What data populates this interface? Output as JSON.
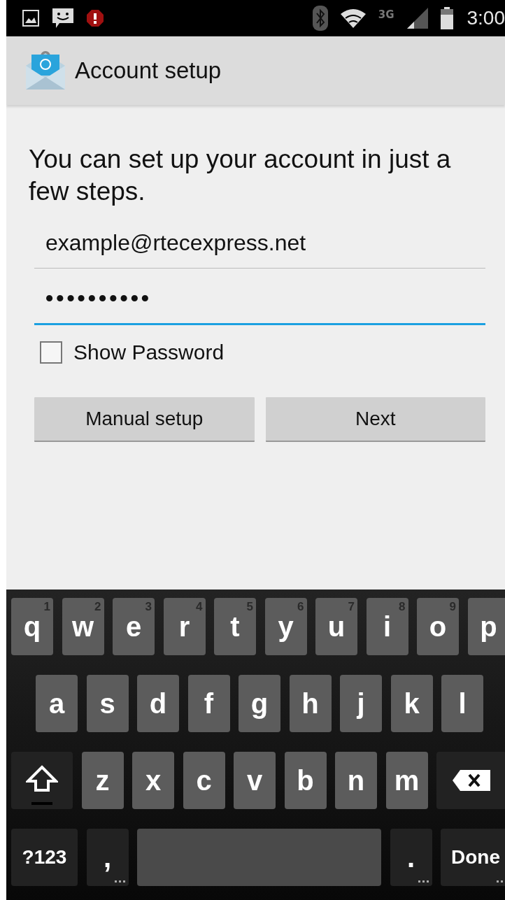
{
  "status_bar": {
    "time": "3:00",
    "network": "3G"
  },
  "app_bar": {
    "title": "Account setup"
  },
  "intro": "You can set up your account in just a few steps.",
  "fields": [
    {
      "kind": "email",
      "value": "example@rtecexpress.net",
      "focused": false
    },
    {
      "kind": "password",
      "value": "••••••••••",
      "focused": true
    }
  ],
  "show_password": {
    "label": "Show Password",
    "checked": false
  },
  "buttons": [
    "Manual setup",
    "Next"
  ],
  "keyboard": {
    "rows": [
      {
        "keys": [
          {
            "kind": "letter",
            "label": "q",
            "hint": "1"
          },
          {
            "kind": "letter",
            "label": "w",
            "hint": "2"
          },
          {
            "kind": "letter",
            "label": "e",
            "hint": "3"
          },
          {
            "kind": "letter",
            "label": "r",
            "hint": "4"
          },
          {
            "kind": "letter",
            "label": "t",
            "hint": "5"
          },
          {
            "kind": "letter",
            "label": "y",
            "hint": "6"
          },
          {
            "kind": "letter",
            "label": "u",
            "hint": "7"
          },
          {
            "kind": "letter",
            "label": "i",
            "hint": "8"
          },
          {
            "kind": "letter",
            "label": "o",
            "hint": "9"
          },
          {
            "kind": "letter",
            "label": "p"
          }
        ]
      },
      {
        "keys": [
          {
            "kind": "letter",
            "label": "a"
          },
          {
            "kind": "letter",
            "label": "s"
          },
          {
            "kind": "letter",
            "label": "d"
          },
          {
            "kind": "letter",
            "label": "f"
          },
          {
            "kind": "letter",
            "label": "g"
          },
          {
            "kind": "letter",
            "label": "h"
          },
          {
            "kind": "letter",
            "label": "j"
          },
          {
            "kind": "letter",
            "label": "k"
          },
          {
            "kind": "letter",
            "label": "l"
          }
        ]
      },
      {
        "keys": [
          {
            "kind": "shift"
          },
          {
            "kind": "letter",
            "label": "z"
          },
          {
            "kind": "letter",
            "label": "x"
          },
          {
            "kind": "letter",
            "label": "c"
          },
          {
            "kind": "letter",
            "label": "v"
          },
          {
            "kind": "letter",
            "label": "b"
          },
          {
            "kind": "letter",
            "label": "n"
          },
          {
            "kind": "letter",
            "label": "m"
          },
          {
            "kind": "delete"
          }
        ]
      },
      {
        "keys": [
          {
            "kind": "symbols",
            "label": "?123"
          },
          {
            "kind": "punct",
            "label": ","
          },
          {
            "kind": "space"
          },
          {
            "kind": "punct",
            "label": "."
          },
          {
            "kind": "action",
            "label": "Done"
          }
        ]
      }
    ]
  }
}
